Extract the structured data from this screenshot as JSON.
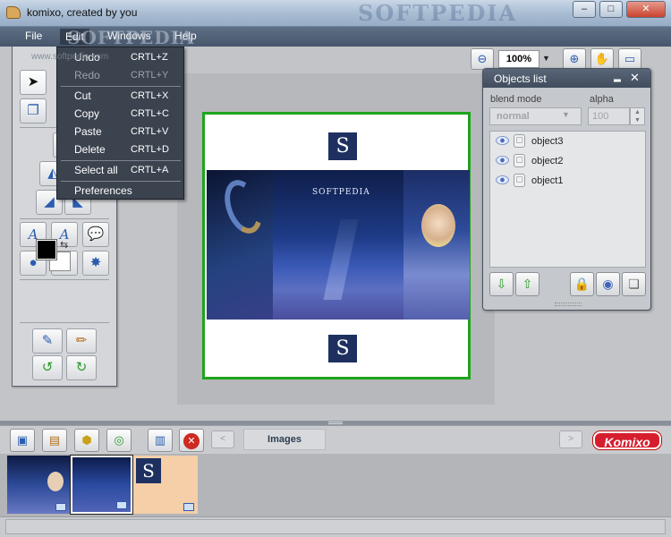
{
  "window": {
    "title": "komixo, created by you",
    "watermark": "SOFTPEDIA",
    "controls": {
      "minimize": "–",
      "maximize": "□",
      "close": "✕"
    }
  },
  "menubar": {
    "items": [
      "File",
      "Edit",
      "Windows",
      "Help"
    ],
    "active": "Edit"
  },
  "edit_menu": {
    "items": [
      {
        "label": "Undo",
        "shortcut": "CRTL+Z",
        "enabled": true
      },
      {
        "label": "Redo",
        "shortcut": "CRTL+Y",
        "enabled": false
      },
      {
        "label": "Cut",
        "shortcut": "CRTL+X",
        "enabled": true
      },
      {
        "label": "Copy",
        "shortcut": "CRTL+C",
        "enabled": true
      },
      {
        "label": "Paste",
        "shortcut": "CRTL+V",
        "enabled": true
      },
      {
        "label": "Delete",
        "shortcut": "CRTL+D",
        "enabled": true
      },
      {
        "label": "Select all",
        "shortcut": "CRTL+A",
        "enabled": true
      },
      {
        "label": "Preferences",
        "shortcut": "",
        "enabled": true
      }
    ]
  },
  "watermarks": {
    "softpedia": "SOFTPEDIA",
    "softpedia_url": "www.softpedia.com"
  },
  "zoom_toolbar": {
    "zoom_value": "100%",
    "icons": [
      "zoom-out-icon",
      "zoom-in-icon",
      "hand-icon",
      "monitor-icon"
    ]
  },
  "tools": {
    "icons": [
      "pointer-icon",
      "copy-icon",
      "flip-icon",
      "rotate-left-icon",
      "rotate-right-icon",
      "text-icon",
      "text-italic-icon",
      "speech-bubble-icon",
      "circle-icon",
      "square-icon",
      "star-icon",
      "pen-icon",
      "brush-icon",
      "refresh-left-icon",
      "refresh-right-icon"
    ],
    "foreground_color": "#000000",
    "background_color": "#FFFFFF"
  },
  "canvas": {
    "border_color": "#1DA41D",
    "top_logo": "S",
    "bottom_logo": "S",
    "image_label": "SOFTPEDIA"
  },
  "objects_panel": {
    "title": "Objects list",
    "blend_mode_label": "blend mode",
    "blend_mode_value": "normal",
    "alpha_label": "alpha",
    "alpha_value": "100",
    "objects": [
      "object3",
      "object2",
      "object1"
    ],
    "buttons": [
      "move-down-icon",
      "move-up-icon",
      "lock-icon",
      "eye-icon",
      "layers-icon"
    ]
  },
  "bottom_bar": {
    "images_label": "Images",
    "prev": "<",
    "next": ">",
    "brand": "Komixo",
    "delete_symbol": "✕"
  },
  "thumbnails": [
    {
      "name": "image1"
    },
    {
      "name": "image2",
      "selected": true
    },
    {
      "name": "image3",
      "logo": "S"
    }
  ]
}
